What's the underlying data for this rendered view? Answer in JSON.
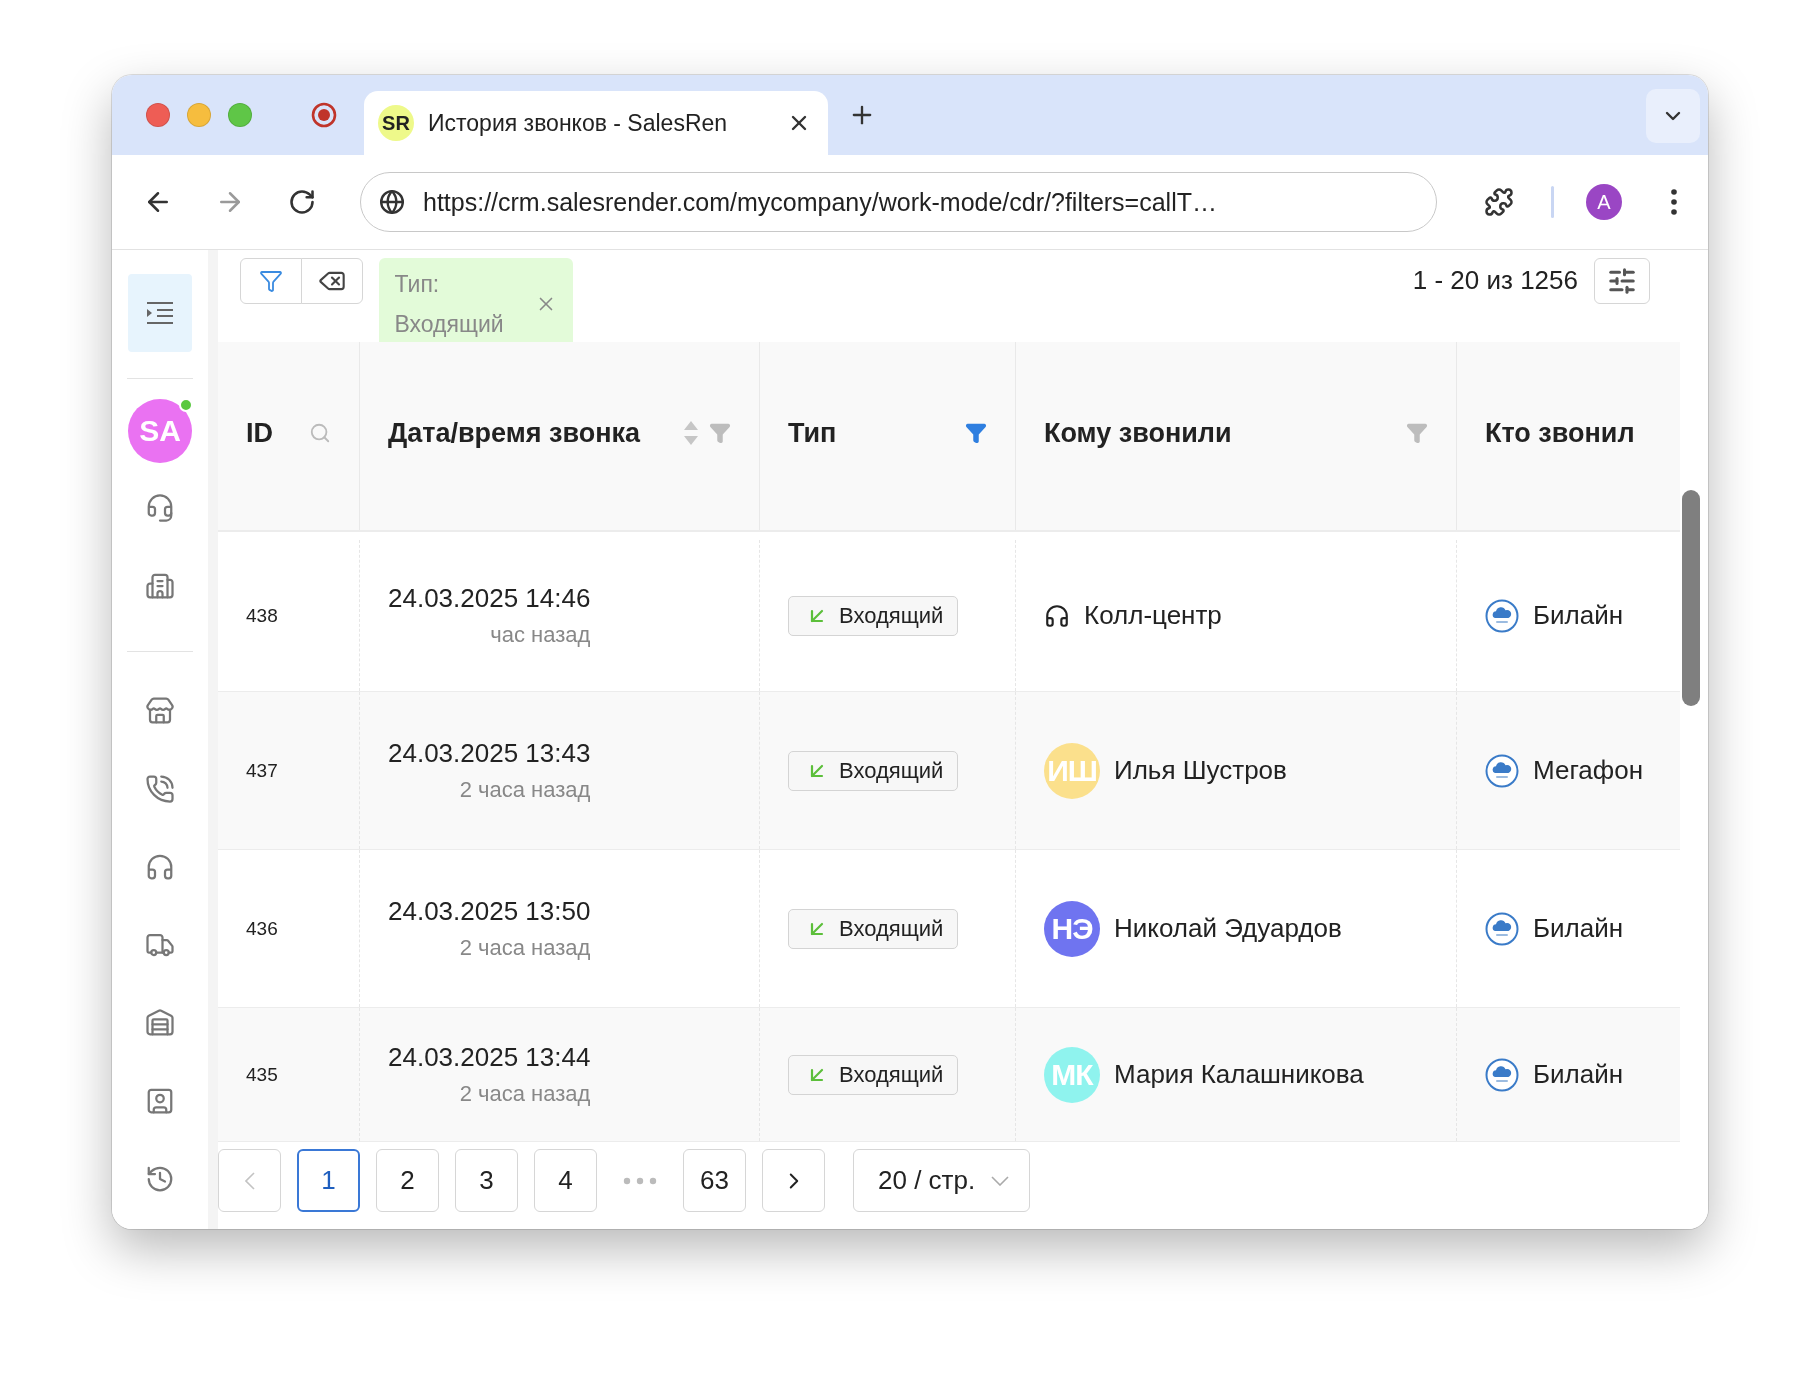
{
  "browser": {
    "tab": {
      "favicon": "SR",
      "title": "История звонков - SalesRen",
      "selected": true
    },
    "url": "https://crm.salesrender.com/mycompany/work-mode/cdr/?filters=callT…",
    "profile_initial": "A"
  },
  "sidebar": {
    "items": [
      {
        "kind": "menu",
        "selected": true
      },
      {
        "kind": "divider"
      },
      {
        "kind": "avatar",
        "selected": false,
        "initials": "SA",
        "online": true
      },
      {
        "kind": "headset",
        "selected": false
      },
      {
        "kind": "building",
        "selected": false
      },
      {
        "kind": "divider"
      },
      {
        "kind": "store",
        "selected": false
      },
      {
        "kind": "phone",
        "selected": false
      },
      {
        "kind": "headphones",
        "selected": false
      },
      {
        "kind": "truck",
        "selected": false
      },
      {
        "kind": "warehouse",
        "selected": false
      },
      {
        "kind": "contact",
        "selected": false
      },
      {
        "kind": "history",
        "selected": false
      }
    ]
  },
  "filters": {
    "active": [
      {
        "label": "Тип:",
        "value": "Входящий"
      }
    ],
    "count": "1 - 20 из 1256"
  },
  "table": {
    "columns": [
      {
        "label": "ID",
        "kind": "search"
      },
      {
        "label": "Дата/время звонка",
        "kind": "sort_filter",
        "filtered": false
      },
      {
        "label": "Тип",
        "kind": "filter",
        "filtered": true
      },
      {
        "label": "Кому звонили",
        "kind": "filter",
        "filtered": false
      },
      {
        "label": "Кто звонил",
        "kind": "plain"
      }
    ],
    "rows": [
      {
        "id": "438",
        "date": "24.03.2025 14:46",
        "ago": "час назад",
        "type": "Входящий",
        "callee": {
          "kind": "team",
          "name": "Колл-центр"
        },
        "caller": "Билайн"
      },
      {
        "id": "437",
        "date": "24.03.2025 13:43",
        "ago": "2 часа назад",
        "type": "Входящий",
        "callee": {
          "kind": "person",
          "name": "Илья Шустров",
          "initials": "ИШ",
          "color": "#fbe08c"
        },
        "caller": "Мегафон"
      },
      {
        "id": "436",
        "date": "24.03.2025 13:50",
        "ago": "2 часа назад",
        "type": "Входящий",
        "callee": {
          "kind": "person",
          "name": "Николай Эдуардов",
          "initials": "НЭ",
          "color": "#6f74f0"
        },
        "caller": "Билайн"
      },
      {
        "id": "435",
        "date": "24.03.2025 13:44",
        "ago": "2 часа назад",
        "type": "Входящий",
        "callee": {
          "kind": "person",
          "name": "Мария Калашникова",
          "initials": "МК",
          "color": "#8ff3ee"
        },
        "caller": "Билайн"
      }
    ]
  },
  "pagination": {
    "prev_disabled": true,
    "next_disabled": false,
    "pages": [
      {
        "kind": "page",
        "label": "1",
        "selected": true
      },
      {
        "kind": "page",
        "label": "2",
        "selected": false
      },
      {
        "kind": "page",
        "label": "3",
        "selected": false
      },
      {
        "kind": "page",
        "label": "4",
        "selected": false
      },
      {
        "kind": "ellipsis"
      },
      {
        "kind": "page",
        "label": "63",
        "selected": false
      }
    ],
    "page_size": "20 / стр."
  }
}
